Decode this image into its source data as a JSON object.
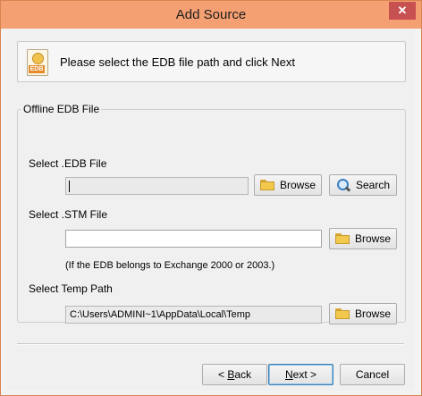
{
  "window": {
    "title": "Add Source",
    "close_glyph": "✕"
  },
  "header": {
    "icon_name": "edb-file-icon",
    "icon_tag": "EDB",
    "instruction": "Please select the EDB file path and click Next"
  },
  "group": {
    "label": "Offline EDB File",
    "edb": {
      "label": "Select .EDB File",
      "value": "",
      "browse_label": "Browse",
      "search_label": "Search"
    },
    "stm": {
      "label": "Select .STM File",
      "value": "",
      "browse_label": "Browse",
      "note": "(If the EDB belongs to Exchange 2000 or 2003.)"
    },
    "temp": {
      "label": "Select Temp Path",
      "value": "C:\\Users\\ADMINI~1\\AppData\\Local\\Temp",
      "browse_label": "Browse"
    }
  },
  "footer": {
    "back_prefix": "< ",
    "back_hotkey": "B",
    "back_rest": "ack",
    "next_hotkey": "N",
    "next_rest": "ext >",
    "cancel_label": "Cancel"
  },
  "colors": {
    "titlebar": "#f5a072",
    "close_button": "#c75050",
    "window_bg": "#f0f0f0"
  }
}
